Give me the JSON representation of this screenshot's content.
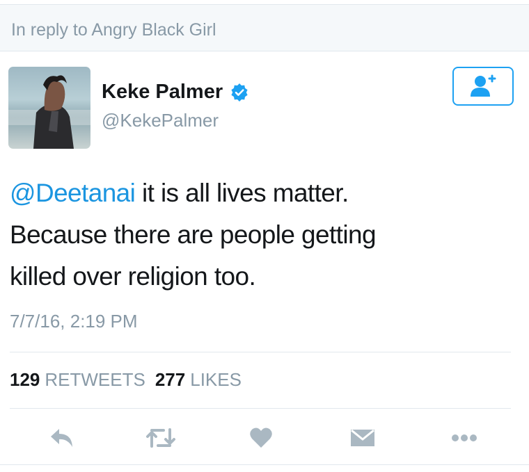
{
  "reply_context": {
    "text": "In reply to Angry Black Girl"
  },
  "author": {
    "name": "Keke Palmer",
    "handle": "@KekePalmer",
    "verified": true,
    "avatar_icon": "profile-photo"
  },
  "follow_button": {
    "icon": "add-user-icon"
  },
  "tweet": {
    "mention": "@Deetanai",
    "text_line1_rest": " it is all lives matter.",
    "text_line2": "Because there are people getting",
    "text_line3": "killed over religion too.",
    "timestamp": "7/7/16, 2:19 PM"
  },
  "stats": {
    "retweets_count": "129",
    "retweets_label": "RETWEETS",
    "likes_count": "277",
    "likes_label": "LIKES"
  },
  "actions": [
    {
      "icon": "reply-icon"
    },
    {
      "icon": "retweet-icon"
    },
    {
      "icon": "like-icon"
    },
    {
      "icon": "direct-message-icon"
    },
    {
      "icon": "more-icon"
    }
  ],
  "colors": {
    "accent": "#1da1f2",
    "mention": "#1b95e0",
    "muted": "#8899a6",
    "text": "#14171a",
    "icon": "#aab8c2"
  }
}
